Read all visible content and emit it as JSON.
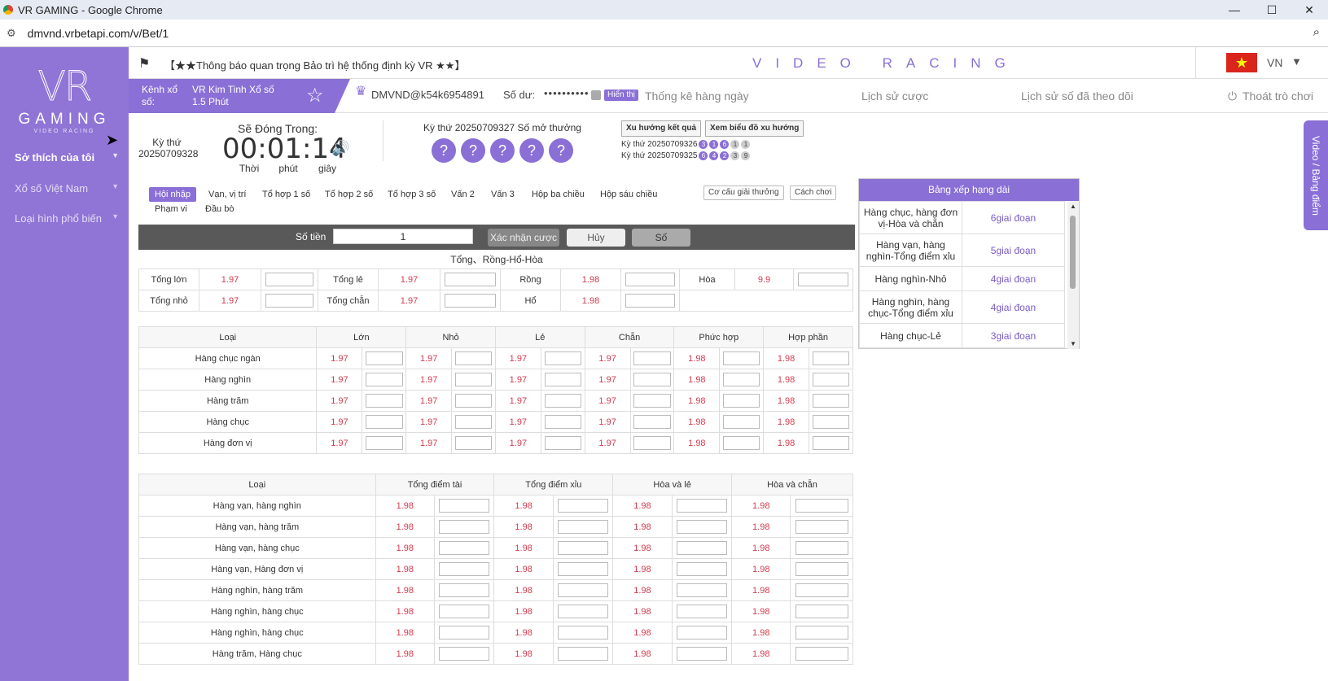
{
  "browser": {
    "title": "VR GAMING - Google Chrome",
    "url": "dmvnd.vrbetapi.com/v/Bet/1"
  },
  "sidebar": {
    "logo_main": "VR",
    "logo_sub": "GAMING",
    "logo_tag": "VIDEO RACING",
    "items": [
      {
        "label": "Sở thích của tôi"
      },
      {
        "label": "Xổ số Việt Nam"
      },
      {
        "label": "Loại hình phổ biến"
      }
    ]
  },
  "topbar": {
    "notice": "【★★Thông báo quan trọng Bảo trì hệ thống định kỳ VR ★★】",
    "brand": "VIDEO RACING",
    "lang": "VN"
  },
  "info": {
    "channel_label": "Kênh xổ số:",
    "channel_name": "VR Kim Tinh Xổ số 1.5 Phút",
    "user": "DMVND@k54k6954891",
    "balance_label": "Số dư:",
    "balance_value": "••••••••••",
    "show_btn": "Hiển thị",
    "nav": [
      "Thống kê hàng ngày",
      "Lịch sử cược",
      "Lịch sử số đã theo dõi",
      "Thoát trò chơi"
    ]
  },
  "draw": {
    "period_label": "Kỳ thứ",
    "period": "20250709328",
    "closing_label": "Sẽ Đóng Trong:",
    "countdown": "00:01:14",
    "units": [
      "Thời",
      "phút",
      "giây"
    ],
    "current_title": "Kỳ thứ 20250709327  Số mở thưởng",
    "balls": [
      "?",
      "?",
      "?",
      "?",
      "?"
    ],
    "trend_btn": "Xu hướng kết quả",
    "chart_btn": "Xem biểu đồ xu hướng",
    "history": [
      {
        "label": "Kỳ thứ 20250709326",
        "balls": [
          "3",
          "1",
          "6",
          "1",
          "1"
        ],
        "grey": [
          false,
          false,
          false,
          true,
          true
        ]
      },
      {
        "label": "Kỳ thứ 20250709325",
        "balls": [
          "6",
          "4",
          "2",
          "3",
          "9"
        ],
        "grey": [
          false,
          false,
          false,
          true,
          true
        ]
      }
    ],
    "side_tab": "Video / Bảng điểm"
  },
  "tabs": {
    "items": [
      "Hội nhập",
      "Vạn, vị trí",
      "Tổ hợp 1 số",
      "Tổ hợp 2 số",
      "Tổ hợp 3 số",
      "Vấn 2",
      "Vấn 3",
      "Hộp ba chiều",
      "Hộp sáu chiều",
      "Phạm vi",
      "Đầu bò"
    ],
    "prize_btn": "Cơ cấu giải thưởng",
    "howto_btn": "Cách chơi"
  },
  "bet": {
    "amount_label": "Số tiền",
    "amount_value": "1",
    "confirm": "Xác nhận cược",
    "cancel": "Hủy",
    "number": "Số"
  },
  "section1": {
    "title": "Tổng、Rồng-Hổ-Hòa",
    "rows": [
      [
        {
          "l": "Tổng lớn",
          "o": "1.97"
        },
        {
          "l": "Tổng lẻ",
          "o": "1.97"
        },
        {
          "l": "Rồng",
          "o": "1.98"
        },
        {
          "l": "Hòa",
          "o": "9.9"
        }
      ],
      [
        {
          "l": "Tổng nhỏ",
          "o": "1.97"
        },
        {
          "l": "Tổng chẵn",
          "o": "1.97"
        },
        {
          "l": "Hổ",
          "o": "1.98"
        }
      ]
    ]
  },
  "section2": {
    "headers": [
      "Loại",
      "Lớn",
      "Nhỏ",
      "Lẻ",
      "Chẵn",
      "Phức hợp",
      "Hợp phần"
    ],
    "rows": [
      {
        "name": "Hàng chục ngàn",
        "odds": [
          "1.97",
          "1.97",
          "1.97",
          "1.97",
          "1.98",
          "1.98"
        ]
      },
      {
        "name": "Hàng nghìn",
        "odds": [
          "1.97",
          "1.97",
          "1.97",
          "1.97",
          "1.98",
          "1.98"
        ]
      },
      {
        "name": "Hàng trăm",
        "odds": [
          "1.97",
          "1.97",
          "1.97",
          "1.97",
          "1.98",
          "1.98"
        ]
      },
      {
        "name": "Hàng chục",
        "odds": [
          "1.97",
          "1.97",
          "1.97",
          "1.97",
          "1.98",
          "1.98"
        ]
      },
      {
        "name": "Hàng đơn vị",
        "odds": [
          "1.97",
          "1.97",
          "1.97",
          "1.97",
          "1.98",
          "1.98"
        ]
      }
    ]
  },
  "section3": {
    "headers": [
      "Loại",
      "Tổng điểm tài",
      "Tổng điểm xỉu",
      "Hòa và lẻ",
      "Hòa và chẵn"
    ],
    "rows": [
      {
        "name": "Hàng vạn, hàng nghìn",
        "odds": [
          "1.98",
          "1.98",
          "1.98",
          "1.98"
        ]
      },
      {
        "name": "Hàng vạn, hàng trăm",
        "odds": [
          "1.98",
          "1.98",
          "1.98",
          "1.98"
        ]
      },
      {
        "name": "Hàng vạn, hàng chục",
        "odds": [
          "1.98",
          "1.98",
          "1.98",
          "1.98"
        ]
      },
      {
        "name": "Hàng vạn, Hàng đơn vị",
        "odds": [
          "1.98",
          "1.98",
          "1.98",
          "1.98"
        ]
      },
      {
        "name": "Hàng nghìn, hàng trăm",
        "odds": [
          "1.98",
          "1.98",
          "1.98",
          "1.98"
        ]
      },
      {
        "name": "Hàng nghìn, hàng chục",
        "odds": [
          "1.98",
          "1.98",
          "1.98",
          "1.98"
        ]
      },
      {
        "name": "Hàng nghìn, hàng chục",
        "odds": [
          "1.98",
          "1.98",
          "1.98",
          "1.98"
        ]
      },
      {
        "name": "Hàng trăm, Hàng chục",
        "odds": [
          "1.98",
          "1.98",
          "1.98",
          "1.98"
        ]
      }
    ]
  },
  "ranking": {
    "title": "Bảng xếp hạng dài",
    "rows": [
      {
        "name": "Hàng chục, hàng đơn vị-Hòa và chẵn",
        "value": "6giai đoạn"
      },
      {
        "name": "Hàng vạn, hàng nghìn-Tổng điểm xỉu",
        "value": "5giai đoạn"
      },
      {
        "name": "Hàng nghìn-Nhỏ",
        "value": "4giai đoạn"
      },
      {
        "name": "Hàng nghìn, hàng chục-Tổng điểm xỉu",
        "value": "4giai đoạn"
      },
      {
        "name": "Hàng chục-Lẻ",
        "value": "3giai đoạn"
      }
    ]
  }
}
